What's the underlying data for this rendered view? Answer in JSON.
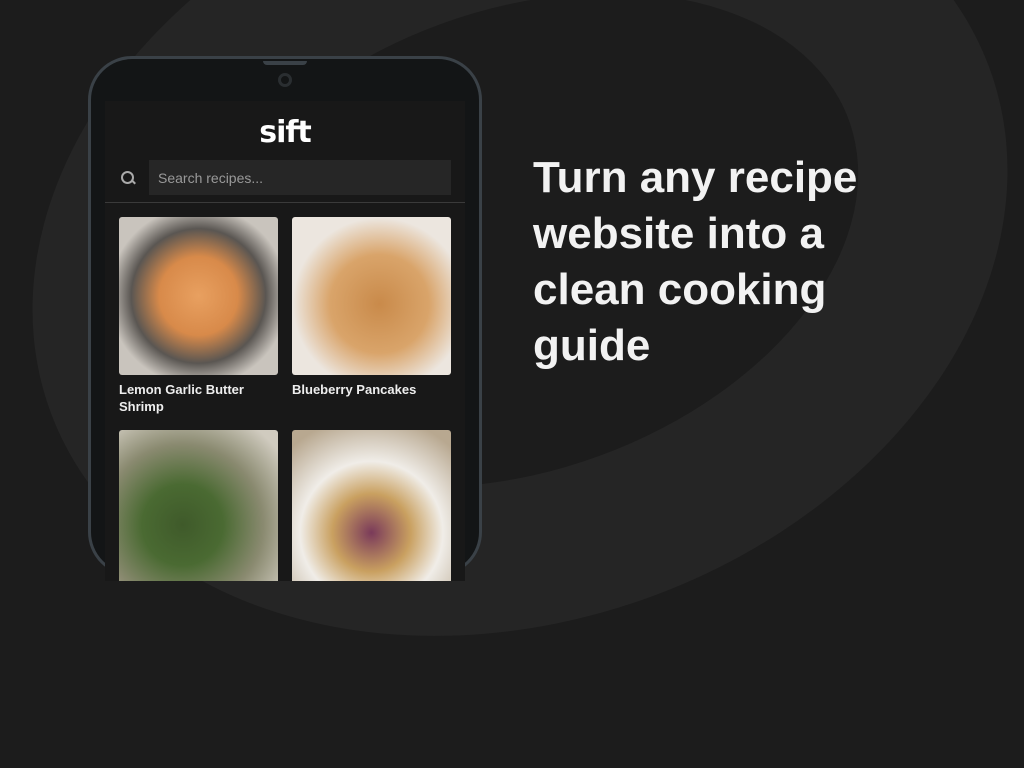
{
  "app": {
    "logo": "sift"
  },
  "search": {
    "placeholder": "Search recipes..."
  },
  "recipes": [
    {
      "title": "Lemon Garlic Butter Shrimp"
    },
    {
      "title": "Blueberry Pancakes"
    },
    {
      "title": ""
    },
    {
      "title": ""
    }
  ],
  "headline": "Turn any recipe website into a clean cooking guide"
}
